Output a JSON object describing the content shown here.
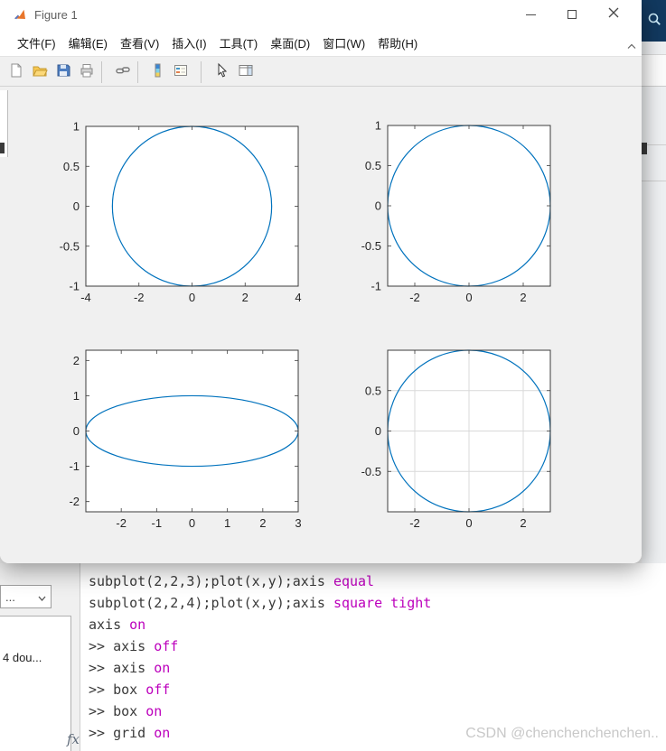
{
  "window": {
    "title": "Figure 1"
  },
  "menu": {
    "items": [
      "文件(F)",
      "编辑(E)",
      "查看(V)",
      "插入(I)",
      "工具(T)",
      "桌面(D)",
      "窗口(W)",
      "帮助(H)"
    ]
  },
  "toolbar": {
    "icons": [
      "new-figure",
      "open-file",
      "save-figure",
      "print-figure",
      "link-plot",
      "insert-colorbar",
      "insert-legend",
      "edit-plot",
      "open-plot-tools"
    ]
  },
  "chart_data": [
    {
      "type": "line",
      "curve": {
        "shape": "ellipse",
        "cx": 0,
        "cy": 0,
        "rx": 3,
        "ry": 1
      },
      "xlim": [
        -4,
        4
      ],
      "ylim": [
        -1,
        1
      ],
      "xticks": [
        -4,
        -2,
        0,
        2,
        4
      ],
      "yticks": [
        -1,
        -0.5,
        0,
        0.5,
        1
      ],
      "grid": false,
      "line_color": "#0072BD"
    },
    {
      "type": "line",
      "curve": {
        "shape": "ellipse",
        "cx": 0,
        "cy": 0,
        "rx": 3,
        "ry": 1
      },
      "xlim": [
        -3,
        3
      ],
      "ylim": [
        -1,
        1
      ],
      "xticks": [
        -2,
        0,
        2
      ],
      "yticks": [
        -1,
        -0.5,
        0,
        0.5,
        1
      ],
      "grid": false,
      "line_color": "#0072BD"
    },
    {
      "type": "line",
      "curve": {
        "shape": "ellipse",
        "cx": 0,
        "cy": 0,
        "rx": 3,
        "ry": 1
      },
      "xlim": [
        -3,
        3
      ],
      "ylim": [
        -2.29,
        2.29
      ],
      "xticks": [
        -2,
        -1,
        0,
        1,
        2,
        3
      ],
      "yticks": [
        -2,
        -1,
        0,
        1,
        2
      ],
      "grid": false,
      "line_color": "#0072BD"
    },
    {
      "type": "line",
      "curve": {
        "shape": "ellipse",
        "cx": 0,
        "cy": 0,
        "rx": 3,
        "ry": 1
      },
      "xlim": [
        -3,
        3
      ],
      "ylim": [
        -1,
        1
      ],
      "xticks": [
        -2,
        0,
        2
      ],
      "yticks": [
        -0.5,
        0,
        0.5
      ],
      "grid": true,
      "line_color": "#0072BD"
    }
  ],
  "command_window": {
    "lines": [
      {
        "tokens": [
          {
            "text": "subplot(2,2,3);plot(x,y);axis ",
            "style": "code"
          },
          {
            "text": "equal",
            "style": "option"
          }
        ]
      },
      {
        "tokens": [
          {
            "text": "subplot(2,2,4);plot(x,y);axis ",
            "style": "code"
          },
          {
            "text": "square tight",
            "style": "option"
          }
        ]
      },
      {
        "tokens": [
          {
            "text": "axis ",
            "style": "code"
          },
          {
            "text": "on",
            "style": "option"
          }
        ]
      },
      {
        "tokens": [
          {
            "text": ">> axis ",
            "style": "code"
          },
          {
            "text": "off",
            "style": "option"
          }
        ]
      },
      {
        "tokens": [
          {
            "text": ">> axis ",
            "style": "code"
          },
          {
            "text": "on",
            "style": "option"
          }
        ]
      },
      {
        "tokens": [
          {
            "text": ">> box ",
            "style": "code"
          },
          {
            "text": "off",
            "style": "option"
          }
        ]
      },
      {
        "tokens": [
          {
            "text": ">> box ",
            "style": "code"
          },
          {
            "text": "on",
            "style": "option"
          }
        ]
      },
      {
        "tokens": [
          {
            "text": ">> grid ",
            "style": "code"
          },
          {
            "text": "on",
            "style": "option"
          }
        ]
      }
    ]
  },
  "side_panel": {
    "overflow_label": "...",
    "workspace_item": "4 dou...",
    "fx_label": "fx"
  },
  "watermark": {
    "text": "CSDN @chenchenchenchen.."
  },
  "colors": {
    "line_blue": "#0072BD",
    "option_magenta": "#BC00BC",
    "navy": "#12395F"
  }
}
